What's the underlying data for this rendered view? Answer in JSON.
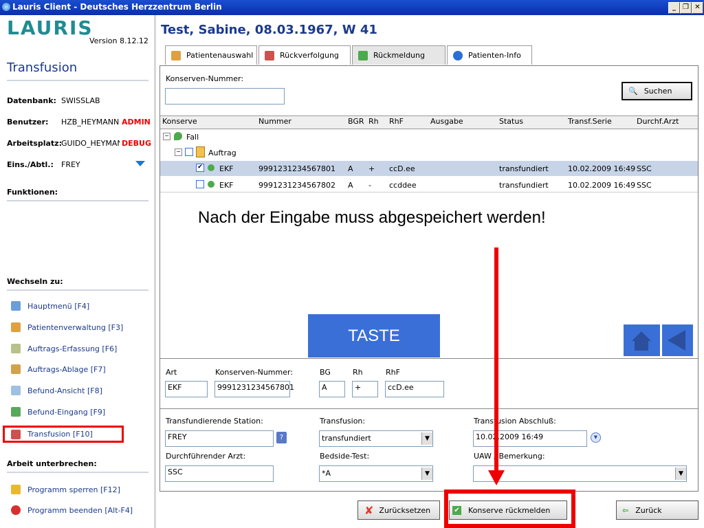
{
  "window": {
    "title": "Lauris Client - Deutsches Herzzentrum Berlin"
  },
  "sidebar": {
    "logo": "LAURIS",
    "version": "Version 8.12.12",
    "section": "Transfusion",
    "info": [
      {
        "label": "Datenbank:",
        "value": "SWISSLAB",
        "flag": ""
      },
      {
        "label": "Benutzer:",
        "value": "HZB_HEYMANNG",
        "flag": "ADMIN"
      },
      {
        "label": "Arbeitsplatz:",
        "value": "GUIDO_HEYMAN",
        "flag": "DEBUG"
      },
      {
        "label": "Eins./Abtl.:",
        "value": "FREY",
        "flag": ""
      }
    ],
    "funktionen": "Funktionen:",
    "wechseln": "Wechseln zu:",
    "nav": [
      {
        "label": "Hauptmenü [F4]",
        "icon": "home-icon"
      },
      {
        "label": "Patientenverwaltung [F3]",
        "icon": "patient-icon"
      },
      {
        "label": "Auftrags-Erfassung [F6]",
        "icon": "order-entry-icon"
      },
      {
        "label": "Auftrags-Ablage [F7]",
        "icon": "order-archive-icon"
      },
      {
        "label": "Befund-Ansicht [F8]",
        "icon": "report-view-icon"
      },
      {
        "label": "Befund-Eingang [F9]",
        "icon": "report-inbox-icon"
      },
      {
        "label": "Transfusion [F10]",
        "icon": "transfusion-icon"
      }
    ],
    "unterbrechen": "Arbeit unterbrechen:",
    "nav2": [
      {
        "label": "Programm sperren [F12]",
        "icon": "lock-icon"
      },
      {
        "label": "Programm beenden [Alt-F4]",
        "icon": "power-icon"
      }
    ]
  },
  "patient": "Test, Sabine, 08.03.1967, W 41",
  "tabs": [
    "Patientenauswahl",
    "Rückverfolgung",
    "Rückmeldung",
    "Patienten-Info"
  ],
  "search": {
    "label": "Konserven-Nummer:",
    "value": "",
    "button": "Suchen"
  },
  "table": {
    "columns": [
      "Konserve",
      "Nummer",
      "BGR",
      "Rh",
      "RhF",
      "Ausgabe",
      "Status",
      "Transf.Serie",
      "Durchf.Arzt"
    ],
    "tree": [
      {
        "label": "Fall"
      },
      {
        "label": "Auftrag"
      }
    ],
    "rows": [
      {
        "checked": true,
        "konserve": "EKF",
        "nummer": "9991231234567801",
        "bgr": "A",
        "rh": "+",
        "rhf": "ccD.ee",
        "ausgabe": "",
        "status": "transfundiert",
        "serie": "10.02.2009 16:49",
        "arzt": "SSC"
      },
      {
        "checked": false,
        "konserve": "EKF",
        "nummer": "9991231234567802",
        "bgr": "A",
        "rh": "-",
        "rhf": "ccddee",
        "ausgabe": "",
        "status": "transfundiert",
        "serie": "10.02.2009 16:49",
        "arzt": "SSC"
      }
    ]
  },
  "annotation": "Nach der Eingabe muss abgespeichert werden!",
  "taste": "TASTE",
  "detail": {
    "art_label": "Art",
    "art": "EKF",
    "nr_label": "Konserven-Nummer:",
    "nr": "9991231234567801",
    "bg_label": "BG",
    "bg": "A",
    "rh_label": "Rh",
    "rh": "+",
    "rhf_label": "RhF",
    "rhf": "ccD.ee"
  },
  "form": {
    "station_label": "Transfundierende Station:",
    "station": "FREY",
    "transfusion_label": "Transfusion:",
    "transfusion": "transfundiert",
    "abschluss_label": "Transfusion Abschluß:",
    "abschluss": "10.02.2009 16:49",
    "arzt_label": "Durchführender Arzt:",
    "arzt": "SSC",
    "bedside_label": "Bedside-Test:",
    "bedside": "*A",
    "uaw_label": "UAW / Bemerkung:",
    "uaw": ""
  },
  "buttons": {
    "reset": "Zurücksetzen",
    "submit": "Konserve rückmelden",
    "back": "Zurück"
  },
  "colors": {
    "accent": "#1b3a8b",
    "highlight": "#ff0000",
    "taste": "#3a6fd8"
  }
}
